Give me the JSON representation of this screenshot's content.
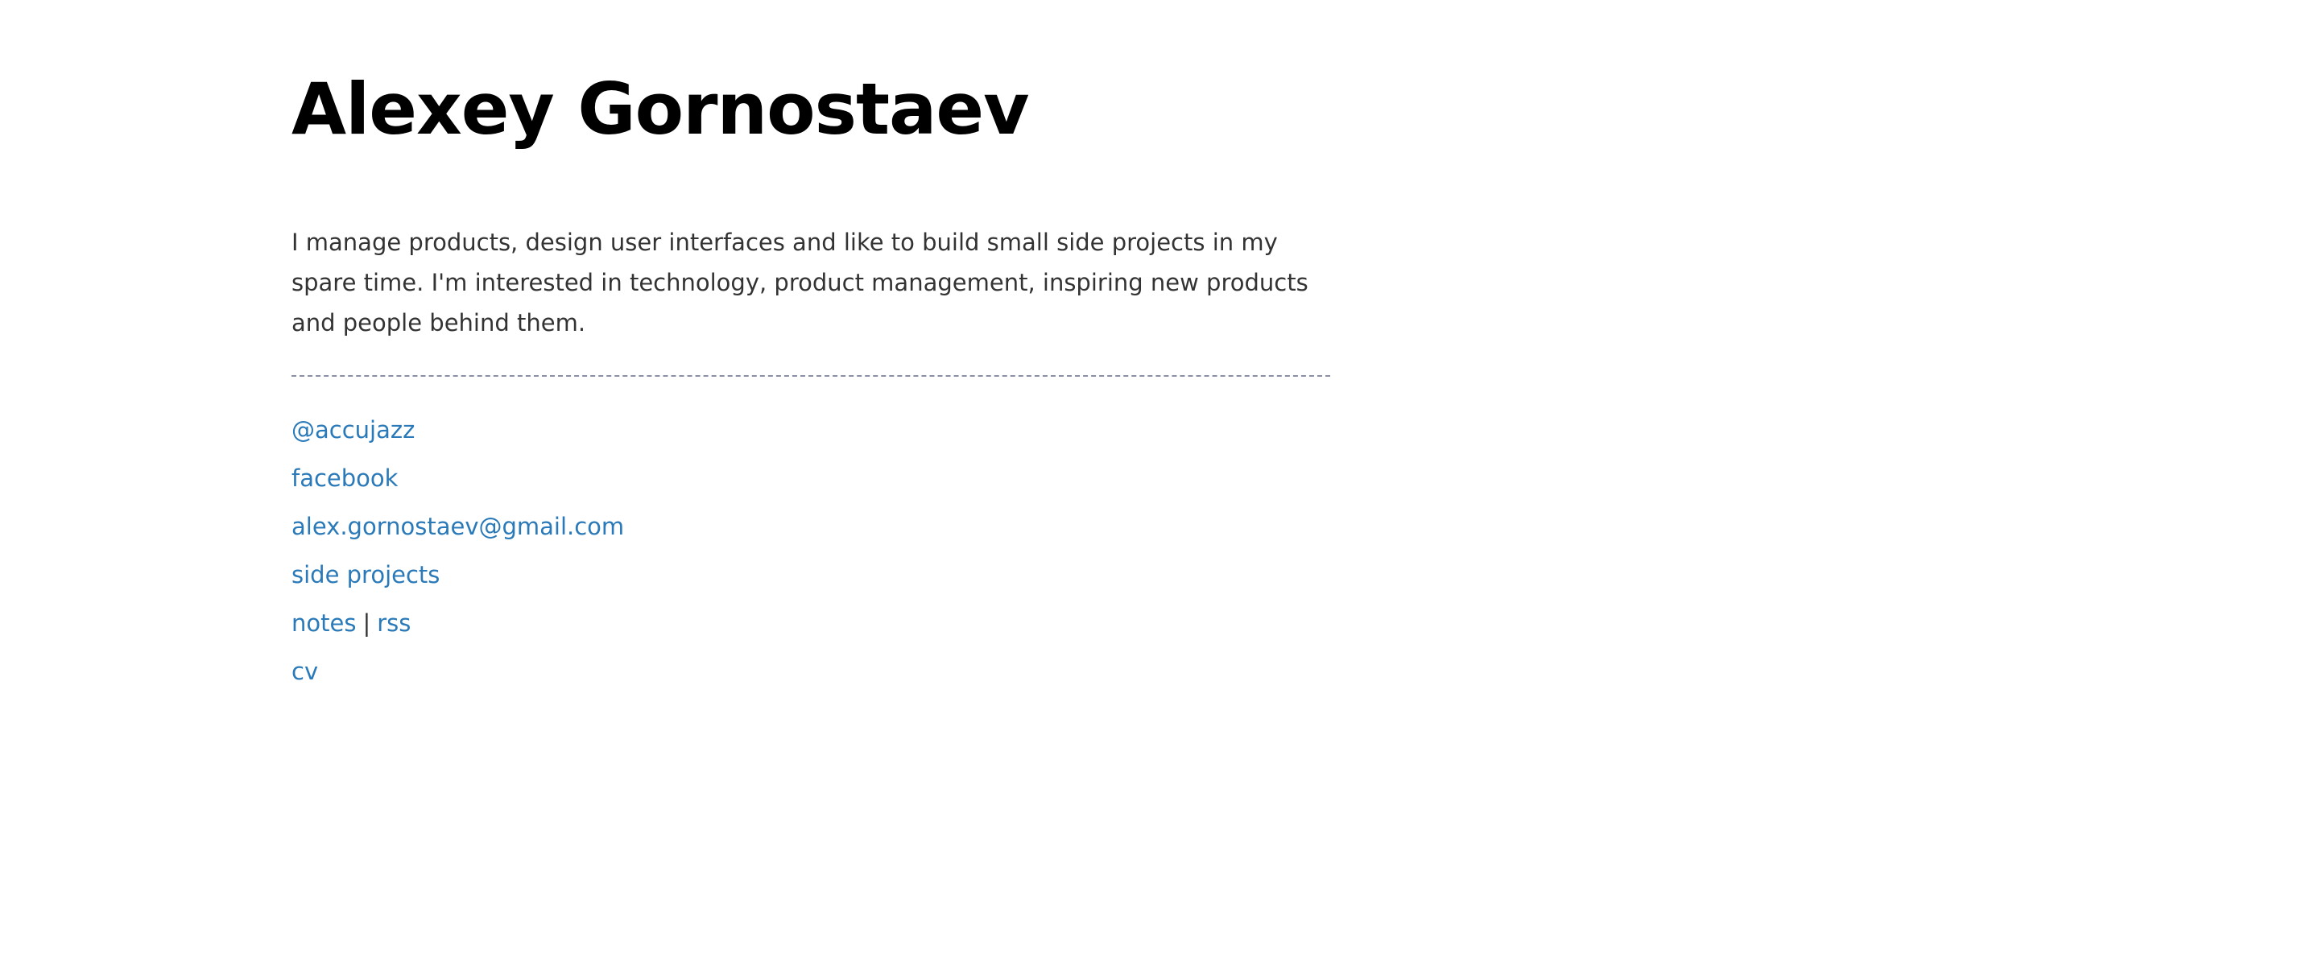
{
  "header": {
    "title": "Alexey Gornostaev"
  },
  "bio": {
    "text": "I manage products, design user interfaces and like to build small side projects in my spare time. I'm interested in technology, product management, inspiring new products and people behind them."
  },
  "links": {
    "twitter": "@accujazz",
    "facebook": "facebook",
    "email": "alex.gornostaev@gmail.com",
    "side_projects": "side projects",
    "notes": "notes",
    "separator": "|",
    "rss": "rss",
    "cv": "cv"
  },
  "colors": {
    "link": "#2a7ab9",
    "text": "#333333",
    "title": "#000000",
    "divider": "#8a8fa6"
  }
}
